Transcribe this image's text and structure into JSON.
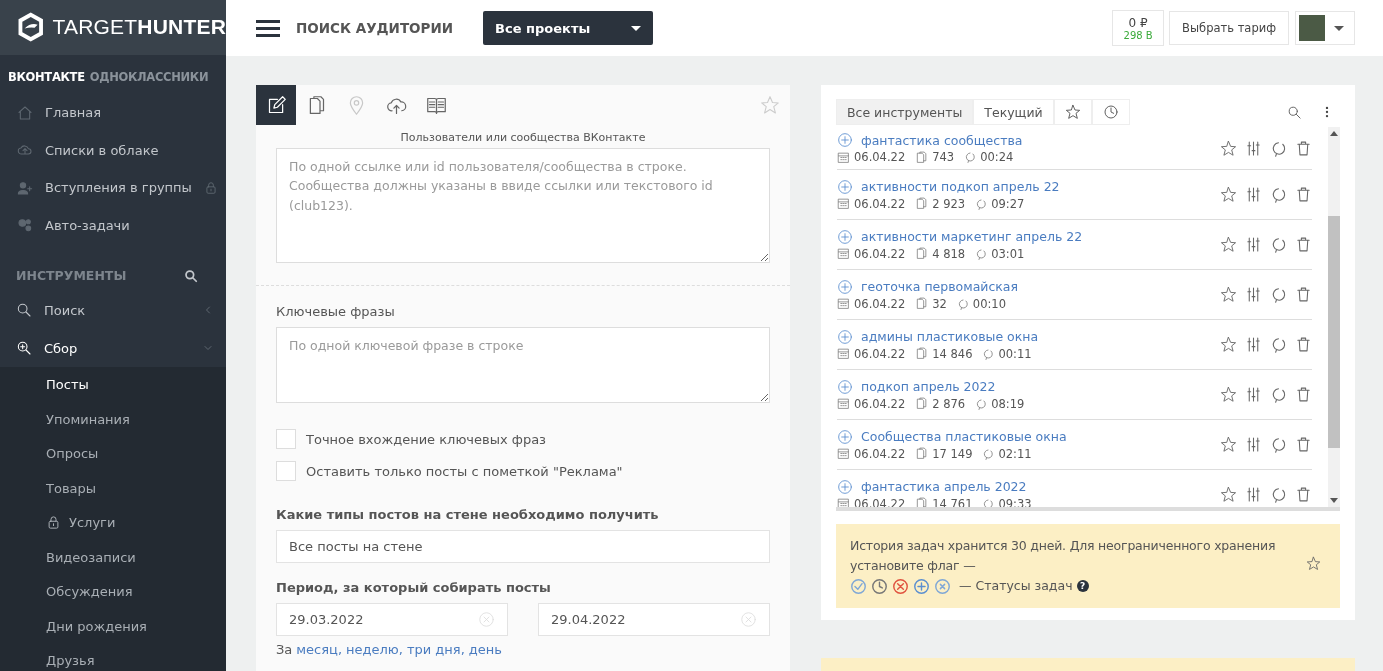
{
  "logo": {
    "text_light": "TARGET",
    "text_bold": "HUNTER"
  },
  "networks": [
    {
      "label": "ВКОНТАКТЕ",
      "selected": true
    },
    {
      "label": "ОДНОКЛАССНИКИ",
      "selected": false
    }
  ],
  "nav": [
    {
      "label": "Главная",
      "locked": false
    },
    {
      "label": "Списки в облаке",
      "locked": false
    },
    {
      "label": "Вступления в группы",
      "locked": true
    },
    {
      "label": "Авто-задачи",
      "locked": false
    }
  ],
  "tools_heading": "ИНСТРУМЕНТЫ",
  "tools": [
    {
      "label": "Поиск",
      "expanded": false
    },
    {
      "label": "Сбор",
      "expanded": true,
      "children": [
        {
          "label": "Посты",
          "selected": true,
          "locked": false
        },
        {
          "label": "Упоминания",
          "selected": false,
          "locked": false
        },
        {
          "label": "Опросы",
          "selected": false,
          "locked": false
        },
        {
          "label": "Товары",
          "selected": false,
          "locked": false
        },
        {
          "label": "Услуги",
          "selected": false,
          "locked": true
        },
        {
          "label": "Видеозаписи",
          "selected": false,
          "locked": false
        },
        {
          "label": "Обсуждения",
          "selected": false,
          "locked": false
        },
        {
          "label": "Дни рождения",
          "selected": false,
          "locked": false
        },
        {
          "label": "Друзья",
          "selected": false,
          "locked": false
        }
      ]
    }
  ],
  "topbar": {
    "title": "ПОИСК АУДИТОРИИ",
    "project_select": "Все проекты",
    "balance": "0 ₽",
    "bonus": "298 В",
    "tariff_button": "Выбрать тариф"
  },
  "form": {
    "tabs": [
      {
        "selected": true
      },
      {
        "selected": false
      },
      {
        "selected": false
      },
      {
        "selected": false
      },
      {
        "selected": false
      }
    ],
    "source_caption": "Пользователи или сообщества ВКонтакте",
    "source_placeholder": "По одной ссылке или id пользователя/сообщества в строке. Сообщества должны указаны в ввиде ссылки или текстового id (club123).",
    "keywords_label": "Ключевые фразы",
    "keywords_placeholder": "По одной ключевой фразе в строке",
    "options": [
      {
        "label": "Точное вхождение ключевых фраз",
        "checked": false
      },
      {
        "label": "Оставить только посты с пометкой \"Реклама\"",
        "checked": false
      }
    ],
    "post_types_label": "Какие типы постов на стене необходимо получить",
    "post_types_value": "Все посты на стене",
    "period_label": "Период, за который собирать посты",
    "date_from": "29.03.2022",
    "date_to": "29.04.2022",
    "quick_prefix": "За",
    "quick_links": [
      "месяц,",
      "неделю,",
      "три дня,",
      "день"
    ]
  },
  "history": {
    "tabs": [
      {
        "label": "Все инструменты",
        "kind": "text",
        "selected": true
      },
      {
        "label": "Текущий",
        "kind": "text",
        "selected": false
      },
      {
        "kind": "favorites",
        "selected": false
      },
      {
        "kind": "recent",
        "selected": false
      }
    ],
    "tasks": [
      {
        "name": "фантастика сообщества",
        "date": "06.04.22",
        "count": "743",
        "time": "00:24"
      },
      {
        "name": "активности подкоп апрель 22",
        "date": "06.04.22",
        "count": "2 923",
        "time": "09:27"
      },
      {
        "name": "активности маркетинг апрель 22",
        "date": "06.04.22",
        "count": "4 818",
        "time": "03:01"
      },
      {
        "name": "геоточка первомайская",
        "date": "06.04.22",
        "count": "32",
        "time": "00:10"
      },
      {
        "name": "админы пластиковые окна",
        "date": "06.04.22",
        "count": "14 846",
        "time": "00:11"
      },
      {
        "name": "подкоп апрель 2022",
        "date": "06.04.22",
        "count": "2 876",
        "time": "08:19"
      },
      {
        "name": "Сообщества пластиковые окна",
        "date": "06.04.22",
        "count": "17 149",
        "time": "02:11"
      },
      {
        "name": "фантастика апрель 2022",
        "date": "06.04.22",
        "count": "14 761",
        "time": "09:33"
      }
    ],
    "note_text": "История задач хранится 30 дней. Для неограниченного хранения установите флаг —",
    "statuses": [
      {
        "kind": "done",
        "color": "#7fa7d6"
      },
      {
        "kind": "waiting",
        "color": "#777777"
      },
      {
        "kind": "error",
        "color": "#e0523f"
      },
      {
        "kind": "new",
        "color": "#5b8fd0"
      },
      {
        "kind": "cancelled",
        "color": "#7fa7d6"
      }
    ],
    "statuses_caption": "— Статусы задач",
    "help_mark": "?"
  }
}
